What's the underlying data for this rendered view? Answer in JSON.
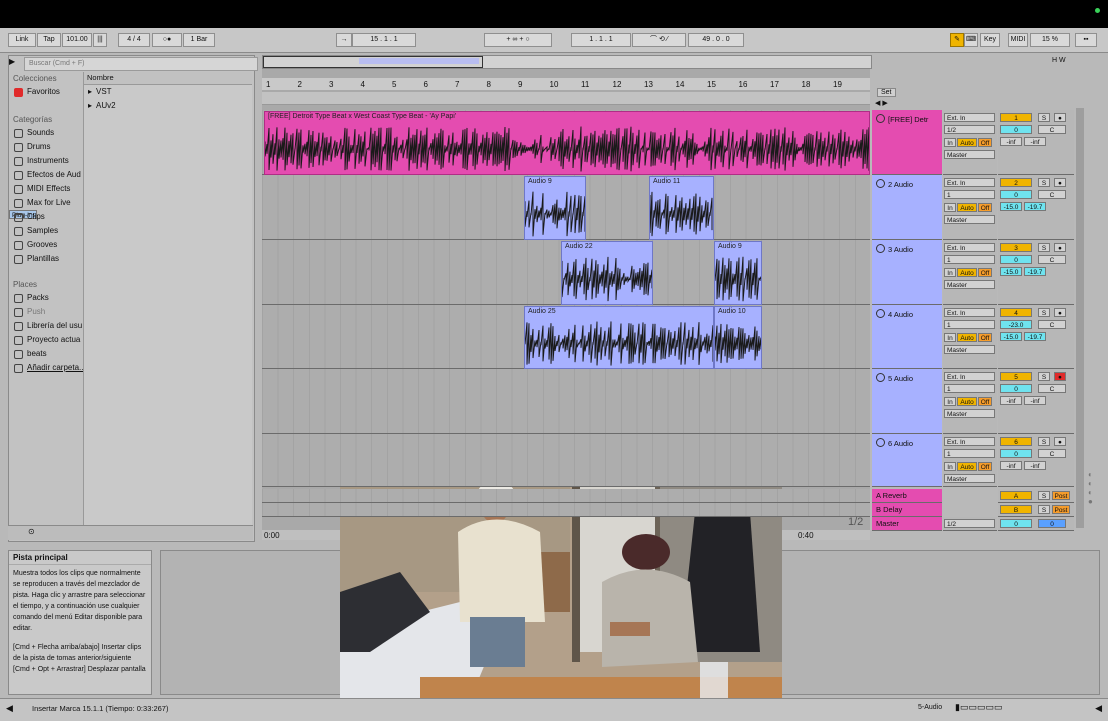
{
  "toolbar": {
    "link": "Link",
    "tap": "Tap",
    "tempo": "101.00",
    "time_sig": "4 / 4",
    "quant": "1 Bar",
    "position": "15 .  1 .  1",
    "loop_start": "1 .  1 .  1",
    "loop_len": "49 .  0 .  0",
    "key": "Key",
    "midi": "MIDI",
    "cpu": "15 %"
  },
  "browser": {
    "search_placeholder": "Buscar (Cmd + F)",
    "collections_header": "Colecciones",
    "favorites": "Favoritos",
    "categories_header": "Categorías",
    "categories": [
      "Sounds",
      "Drums",
      "Instruments",
      "Efectos de Aud",
      "MIDI Effects",
      "Max for Live",
      "Plug-Ins",
      "Clips",
      "Samples",
      "Grooves",
      "Plantillas"
    ],
    "places_header": "Places",
    "places": [
      "Packs",
      "Push",
      "Librería del usu",
      "Proyecto actua",
      "beats",
      "Añadir carpeta..."
    ],
    "name_header": "Nombre",
    "items": [
      "VST",
      "AUv2"
    ]
  },
  "arrangement": {
    "ruler": [
      "1",
      "2",
      "3",
      "4",
      "5",
      "6",
      "7",
      "8",
      "9",
      "10",
      "11",
      "12",
      "13",
      "14",
      "15",
      "16",
      "17",
      "18",
      "19"
    ],
    "set_label": "Set",
    "time_start": "0:00",
    "time_end": "0:40",
    "page_indicator": "1/2"
  },
  "tracks": [
    {
      "num": "1",
      "name": "[FREE] Detr",
      "input": "Ext. In",
      "ch": "1/2",
      "vol": "0",
      "pan": "C",
      "s1": "-inf",
      "s2": "-inf",
      "color": "#e44cb0",
      "clips": [
        {
          "name": "[FREE] Detroit Type Beat x West Coast Type Beat - 'Ay Papi'"
        }
      ]
    },
    {
      "num": "2",
      "name": "2 Audio",
      "input": "Ext. In",
      "ch": "1",
      "vol": "0",
      "pan": "C",
      "s1": "-15.0",
      "s2": "-19.7",
      "color": "#a7b1ff",
      "clips": [
        {
          "name": "Audio 9"
        },
        {
          "name": "Audio 11"
        }
      ]
    },
    {
      "num": "3",
      "name": "3 Audio",
      "input": "Ext. In",
      "ch": "1",
      "vol": "0",
      "pan": "C",
      "s1": "-15.0",
      "s2": "-19.7",
      "color": "#a7b1ff",
      "clips": [
        {
          "name": "Audio 22"
        },
        {
          "name": "Audio 9"
        }
      ]
    },
    {
      "num": "4",
      "name": "4 Audio",
      "input": "Ext. In",
      "ch": "1",
      "vol": "-23.0",
      "pan": "C",
      "s1": "-15.0",
      "s2": "-19.7",
      "color": "#a7b1ff",
      "clips": [
        {
          "name": "Audio 25"
        },
        {
          "name": "Audio 10"
        }
      ]
    },
    {
      "num": "5",
      "name": "5 Audio",
      "input": "Ext. In",
      "ch": "1",
      "vol": "0",
      "pan": "C",
      "s1": "-inf",
      "s2": "-inf",
      "color": "#a7b1ff",
      "clips": []
    },
    {
      "num": "6",
      "name": "6 Audio",
      "input": "Ext. In",
      "ch": "1",
      "vol": "0",
      "pan": "C",
      "s1": "-inf",
      "s2": "-inf",
      "color": "#a7b1ff",
      "clips": []
    }
  ],
  "track_controls": {
    "in": "In",
    "auto": "Auto",
    "off": "Off",
    "master": "Master",
    "solo": "S"
  },
  "returns": [
    {
      "letter": "A",
      "name": "A Reverb",
      "post": "Post"
    },
    {
      "letter": "B",
      "name": "B Delay",
      "post": "Post"
    }
  ],
  "master": {
    "name": "Master",
    "ch": "1/2",
    "vol": "0",
    "pan": "0"
  },
  "info": {
    "title": "Pista principal",
    "body1": "Muestra todos los clips que normalmente se reproducen a través del mezclador de pista. Haga clic y arrastre para seleccionar el tiempo, y a continuación use cualquier comando del menú Editar disponible para editar.",
    "body2": "[Cmd + Flecha arriba/abajo] Insertar clips de la pista de tomas anterior/siguiente",
    "body3": "[Cmd + Opt + Arrastrar] Desplazar pantalla"
  },
  "status": {
    "message": "Insertar Marca 15.1.1 (Tiempo: 0:33:267)",
    "track": "5-Audio"
  },
  "colors": {
    "clip_pink": "#e44cb0",
    "clip_blue": "#a7b1ff",
    "track_yellow": "#f0b400",
    "cyan": "#6fe3ef",
    "orange": "#f59c2b",
    "record_red": "#e02a2a"
  }
}
